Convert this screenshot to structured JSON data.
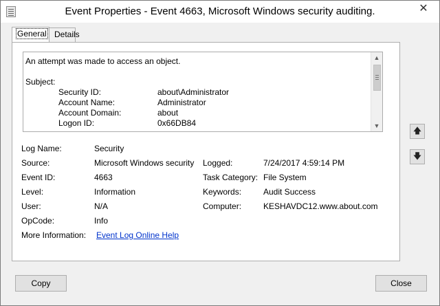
{
  "window": {
    "title": "Event Properties - Event 4663, Microsoft Windows security auditing.",
    "close_glyph": "✕"
  },
  "tabs": [
    {
      "label": "General"
    },
    {
      "label": "Details"
    }
  ],
  "description": {
    "lines": [
      "An attempt was made to access an object.",
      "Subject:"
    ],
    "subject_rows": [
      {
        "label": "Security ID:",
        "value": "about\\Administrator"
      },
      {
        "label": "Account Name:",
        "value": "Administrator"
      },
      {
        "label": "Account Domain:",
        "value": "about"
      },
      {
        "label": "Logon ID:",
        "value": "0x66DB84"
      }
    ]
  },
  "fields": {
    "log_name": {
      "label": "Log Name:",
      "value": "Security"
    },
    "source": {
      "label": "Source:",
      "value": "Microsoft Windows security"
    },
    "logged": {
      "label": "Logged:",
      "value": "7/24/2017 4:59:14 PM"
    },
    "event_id": {
      "label": "Event ID:",
      "value": "4663"
    },
    "task_category": {
      "label": "Task Category:",
      "value": "File System"
    },
    "level": {
      "label": "Level:",
      "value": "Information"
    },
    "keywords": {
      "label": "Keywords:",
      "value": "Audit Success"
    },
    "user": {
      "label": "User:",
      "value": "N/A"
    },
    "computer": {
      "label": "Computer:",
      "value": "KESHAVDC12.www.about.com"
    },
    "opcode": {
      "label": "OpCode:",
      "value": "Info"
    },
    "more_info": {
      "label": "More Information:",
      "link": "Event Log Online Help"
    }
  },
  "buttons": {
    "copy": "Copy",
    "close": "Close"
  },
  "icons": {
    "up": "🡅",
    "down": "🡇",
    "scroll_up": "▲",
    "scroll_down": "▼"
  }
}
